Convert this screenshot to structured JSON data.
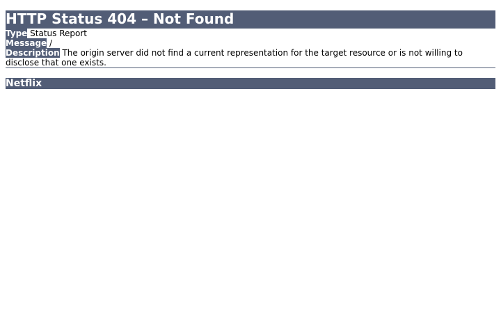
{
  "page": {
    "title": "HTTP Status 404 – Not Found",
    "type_label": "Type",
    "type_value": "Status Report",
    "message_label": "Message",
    "message_value": "/",
    "description_label": "Description",
    "description_value": "The origin server did not find a current representation for the target resource or is not willing to disclose that one exists.",
    "footer": "Netflix"
  },
  "colors": {
    "header_bg": "#525d76",
    "header_text": "#ffffff",
    "body_text": "#000000"
  }
}
